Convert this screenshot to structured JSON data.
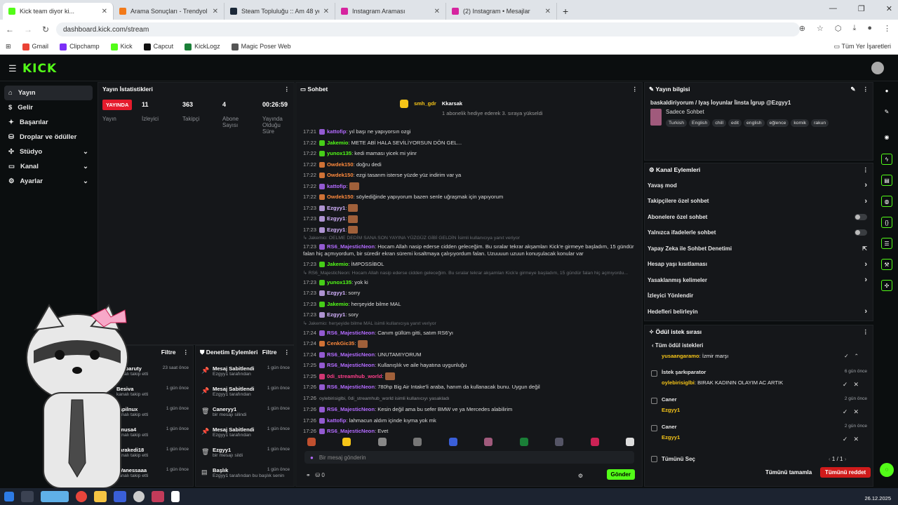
{
  "browser": {
    "tabs": [
      {
        "title": "Kick team diyor ki...",
        "color": "#53fc18",
        "active": true
      },
      {
        "title": "Arama Sonuçları - Trendyol",
        "color": "#f27a1a",
        "active": false
      },
      {
        "title": "Steam Topluluğu :: Am 48 year",
        "color": "#1b2838",
        "active": false
      },
      {
        "title": "Instagram Araması",
        "color": "#d6249f",
        "active": false
      },
      {
        "title": "(2) Instagram • Mesajlar",
        "color": "#d6249f",
        "active": false
      }
    ],
    "url": "dashboard.kick.com/stream",
    "bookmarks": [
      "Gmail",
      "Clipchamp",
      "Kick",
      "Capcut",
      "KickLogz",
      "Magic Poser Web"
    ],
    "all_bookmarks": "Tüm Yer İşaretleri"
  },
  "nav": [
    {
      "label": "Yayın",
      "active": true,
      "chev": false
    },
    {
      "label": "Gelir",
      "active": false,
      "chev": false
    },
    {
      "label": "Başarılar",
      "active": false,
      "chev": false
    },
    {
      "label": "Droplar ve ödüller",
      "active": false,
      "chev": false
    },
    {
      "label": "Stüdyo",
      "active": false,
      "chev": true
    },
    {
      "label": "Kanal",
      "active": false,
      "chev": true
    },
    {
      "label": "Ayarlar",
      "active": false,
      "chev": true
    }
  ],
  "stats": {
    "title": "Yayın İstatistikleri",
    "live": "YAYINDA",
    "live_label": "Yayın",
    "viewers": "11",
    "viewers_label": "İzleyici",
    "followers": "363",
    "followers_label": "Takipçi",
    "subs": "4",
    "subs_label": "Abone Sayısı",
    "uptime": "00:26:59",
    "uptime_label": "Yayında Olduğu Süre"
  },
  "chat": {
    "title": "Sohbet",
    "pinned_user1": "smh_gdr",
    "pinned_user2": "Kkarsak",
    "pinned_sub": "1 abonelik hediye ederek 3. sıraya yükseldi",
    "messages": [
      {
        "time": "17:21",
        "user": "kattofip",
        "color": "#b36bff",
        "text": "yıl başı ne yapıyorsın ozgi",
        "type": "msg"
      },
      {
        "time": "17:22",
        "user": "Jakemio",
        "color": "#53fc18",
        "text": "METE ABİ HALA SEVİLİYORSUN DÖN GEL...",
        "type": "msg"
      },
      {
        "time": "17:22",
        "user": "yunox135",
        "color": "#53fc18",
        "text": "kedi maması yicek mi yiinr",
        "type": "msg"
      },
      {
        "time": "17:22",
        "user": "Owdek150",
        "color": "#ff8a3d",
        "text": "doğru dedi",
        "type": "msg"
      },
      {
        "time": "17:22",
        "user": "Owdek150",
        "color": "#ff8a3d",
        "text": "ezgi tasarım isterse yüzde yüz indirim var ya",
        "type": "msg"
      },
      {
        "time": "17:22",
        "user": "kattofip",
        "color": "#b36bff",
        "text": "",
        "type": "msg"
      },
      {
        "time": "17:22",
        "user": "Owdek150",
        "color": "#ff8a3d",
        "text": "söylediğinde yapıyorum bazen senle uğraşmak için yapıyorum",
        "type": "msg"
      },
      {
        "time": "17:23",
        "user": "Ezgyy1",
        "color": "#d5b3ff",
        "text": "",
        "type": "msg"
      },
      {
        "time": "17:23",
        "user": "Ezgyy1",
        "color": "#d5b3ff",
        "text": "",
        "type": "msg"
      },
      {
        "time": "17:23",
        "user": "Ezgyy1",
        "color": "#d5b3ff",
        "text": "",
        "type": "msg"
      },
      {
        "time": "",
        "user": "",
        "color": "#6b6f74",
        "text": "↳ Jakemio: OELME DEDİM SANA SON YAYINA YÜZGÜZ GİBİ GELDİN İsimli kullanıcıya yanıt veriyor",
        "type": "sys"
      },
      {
        "time": "17:23",
        "user": "RS6_MajesticNeon",
        "color": "#b36bff",
        "text": "Hocam Allah nasip ederse cidden geleceğim. Bu sıralar tekrar akşamları Kick'e girmeye başladım, 15 gündür falan hiç açmıyordum, bir süredir ekran süremi kısaltmaya çalışıyordum falan. Uzuuuun uzuun konuşulacak konular var",
        "type": "wrap"
      },
      {
        "time": "17:23",
        "user": "Jakemio",
        "color": "#53fc18",
        "text": "İMPOSSİBOL",
        "type": "msg"
      },
      {
        "time": "",
        "user": "",
        "color": "#6b6f74",
        "text": "↳ RS6_MajesticNeon: Hocam Allah nasip ederse cidden geleceğim. Bu sıralar tekrar akşamları Kick'e girmeye başladım, 15 gündür falan hiç açmıyordu...",
        "type": "sys"
      },
      {
        "time": "17:23",
        "user": "yunox135",
        "color": "#53fc18",
        "text": "yok ki",
        "type": "msg"
      },
      {
        "time": "17:23",
        "user": "Ezgyy1",
        "color": "#d5b3ff",
        "text": "sorry",
        "type": "msg"
      },
      {
        "time": "17:23",
        "user": "Jakemio",
        "color": "#53fc18",
        "text": "herşeyide bilme MAL",
        "type": "msg"
      },
      {
        "time": "17:23",
        "user": "Ezgyy1",
        "color": "#d5b3ff",
        "text": "sory",
        "type": "msg"
      },
      {
        "time": "",
        "user": "",
        "color": "#6b6f74",
        "text": "↳ Jakemio: herşeyide bilme MAL isimli kullanıcıya yanıt veriyor",
        "type": "sys"
      },
      {
        "time": "17:24",
        "user": "RS6_MajesticNeon",
        "color": "#b36bff",
        "text": "Canım güllüm gitti, satım RS6'yı",
        "type": "msg"
      },
      {
        "time": "17:24",
        "user": "CenkGic35",
        "color": "#ff8a3d",
        "text": "",
        "type": "msg"
      },
      {
        "time": "17:24",
        "user": "RS6_MajesticNeon",
        "color": "#b36bff",
        "text": "UNUTAMIYORUM",
        "type": "msg"
      },
      {
        "time": "17:25",
        "user": "RS6_MajesticNeon",
        "color": "#b36bff",
        "text": "Kullanışlık ve aile hayatına uygunluğu",
        "type": "msg"
      },
      {
        "time": "17:25",
        "user": "0di_streamhub_world",
        "color": "#ff3e8a",
        "text": "",
        "type": "msg"
      },
      {
        "time": "17:26",
        "user": "RS6_MajesticNeon",
        "color": "#b36bff",
        "text": "780hp Big Air Intake'li araba, hanım da kullanacak bunu. Uygun değil",
        "type": "msg"
      },
      {
        "time": "17:26",
        "user": "",
        "color": "#6b6f74",
        "text": "oylebirisiglbi, 0di_streamhub_world isimli kullanıcıyı yasakladı",
        "type": "ban"
      },
      {
        "time": "17:26",
        "user": "RS6_MajesticNeon",
        "color": "#b36bff",
        "text": "Kesin değil ama bu sefer BMW ve ya Mercedes alabilirim",
        "type": "msg"
      },
      {
        "time": "17:26",
        "user": "kattofip",
        "color": "#b36bff",
        "text": "lahmacun aldım içinde kıyma yok mk",
        "type": "msg"
      },
      {
        "time": "17:26",
        "user": "RS6_MajesticNeon",
        "color": "#b36bff",
        "text": "Evet",
        "type": "msg"
      }
    ],
    "input_placeholder": "Bir mesaj gönderin",
    "count": "0",
    "send": "Gönder"
  },
  "follows": {
    "filter": "Filtre",
    "items": [
      {
        "name": "xc_baruty",
        "sub": "kanalı takip etti",
        "date": "23 saat önce"
      },
      {
        "name": "Besiva",
        "sub": "kanalı takip etti",
        "date": "1 gün önce"
      },
      {
        "name": "zapilnux",
        "sub": "kanalı takip etti",
        "date": "1 gün önce"
      },
      {
        "name": "4musa4",
        "sub": "kanalı takip etti",
        "date": "1 gün önce"
      },
      {
        "name": "karakedi18",
        "sub": "kanalı takip etti",
        "date": "1 gün önce"
      },
      {
        "name": "1Vanessaaa",
        "sub": "kanalı takip etti",
        "date": "1 gün önce"
      }
    ]
  },
  "modlog": {
    "title": "Denetim Eylemleri",
    "filter": "Filtre",
    "items": [
      {
        "name": "Mesaj Sabitlendi",
        "sub": "Ezgyy1 tarafından",
        "date": "1 gün önce",
        "icon": "📌"
      },
      {
        "name": "Mesaj Sabitlendi",
        "sub": "Ezgyy1 tarafından",
        "date": "1 gün önce",
        "icon": "📌"
      },
      {
        "name": "Caneryy1",
        "sub": "bir mesajı silindi",
        "date": "1 gün önce",
        "icon": "🗑"
      },
      {
        "name": "Mesaj Sabitlendi",
        "sub": "Ezgyy1 tarafından",
        "date": "1 gün önce",
        "icon": "📌"
      },
      {
        "name": "Ezgyy1",
        "sub": "bir mesajı sildi",
        "date": "1 gün önce",
        "icon": "🗑"
      },
      {
        "name": "Başlık",
        "sub": "Ezgyy1 tarafından bu başlık senin",
        "date": "1 gün önce",
        "icon": "▤"
      }
    ]
  },
  "stream_info": {
    "title": "Yayın bilgisi",
    "stream_title": "baskaldiriyorum / Iyaş İoyunlar İinsta İgrup @Ezgyy1",
    "category": "Sadece Sohbet",
    "tags": [
      "Turkish",
      "English",
      "chill",
      "edit",
      "english",
      "eğlence",
      "komik",
      "rakun"
    ]
  },
  "channel_actions": {
    "title": "Kanal Eylemleri",
    "items": [
      {
        "label": "Yavaş mod",
        "ctl": "chev"
      },
      {
        "label": "Takipçilere özel sohbet",
        "ctl": "chev"
      },
      {
        "label": "Abonelere özel sohbet",
        "ctl": "toggle"
      },
      {
        "label": "Yalnızca ifadelerle sohbet",
        "ctl": "toggle"
      },
      {
        "label": "Yapay Zeka ile Sohbet Denetimi",
        "ctl": "ext"
      },
      {
        "label": "Hesap yaşı kısıtlaması",
        "ctl": "chev"
      },
      {
        "label": "Yasaklanmış kelimeler",
        "ctl": "chev"
      },
      {
        "label": "İzleyici Yönlendir",
        "ctl": "none"
      },
      {
        "label": "Hedefleri belirleyin",
        "ctl": "chev"
      }
    ]
  },
  "rewards": {
    "title": "Ödül istek sırası",
    "back": "Tüm ödül istekleri",
    "top": {
      "user": "yusaangaramo",
      "text": "İzmir marşı"
    },
    "items": [
      {
        "name": "İstek şarkıparator",
        "user": "oylebirisiglbi",
        "text": "BIRAK KADININ OLAYIM AC ARTIK",
        "date": "6 gün önce"
      },
      {
        "name": "Caner",
        "user": "Ezgyy1",
        "text": "",
        "date": "2 gün önce"
      },
      {
        "name": "Caner",
        "user": "Ezgyy1",
        "text": "",
        "date": "2 gün önce"
      }
    ],
    "select_all": "Tümünü Seç",
    "page": "1 / 1",
    "accept_all": "Tümünü tamamla",
    "reject_all": "Tümünü reddet"
  },
  "taskbar": {
    "date": "26.12.2025"
  }
}
